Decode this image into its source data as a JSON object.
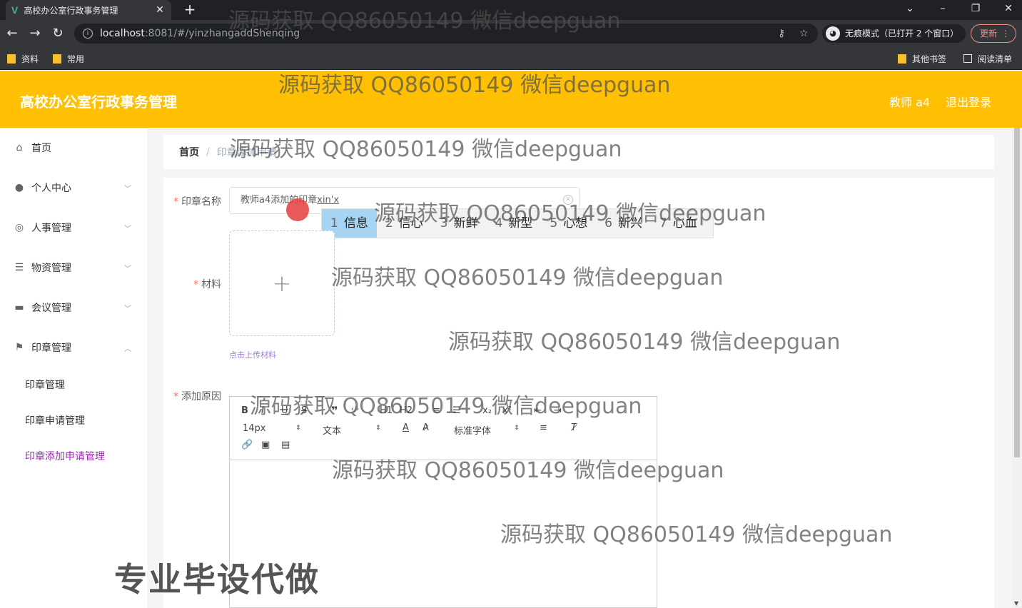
{
  "browser": {
    "tab_title": "高校办公室行政事务管理",
    "tab_logo": "V",
    "tab_close": "✕",
    "new_tab": "+",
    "url_host": "localhost",
    "url_rest": ":8081/#/yinzhangaddShenqing",
    "incognito": "无痕模式（已打开 2 个窗口）",
    "update_label": "更新",
    "bookmarks": [
      "资料",
      "常用"
    ],
    "other_bookmarks": "其他书签",
    "reading_list": "阅读清单",
    "icons": [
      "back-icon",
      "forward-icon",
      "reload-icon",
      "info-icon",
      "key-icon",
      "star-icon",
      "incognito-icon",
      "menu-dots-icon",
      "folder-icon",
      "minimize-icon",
      "restore-icon",
      "close-icon",
      "chevron-down-icon"
    ]
  },
  "header": {
    "title": "高校办公室行政事务管理",
    "user": "教师 a4",
    "logout": "退出登录",
    "bg_color": "#ffc003"
  },
  "sidebar": {
    "items": [
      {
        "label": "首页",
        "icon": "home-icon"
      },
      {
        "label": "个人中心",
        "icon": "user-icon"
      },
      {
        "label": "人事管理",
        "icon": "compass-icon"
      },
      {
        "label": "物资管理",
        "icon": "list-icon"
      },
      {
        "label": "会议管理",
        "icon": "monitor-icon"
      },
      {
        "label": "印章管理",
        "icon": "flag-icon"
      }
    ],
    "sub_items": [
      "印章管理",
      "印章申请管理",
      "印章添加申请管理"
    ],
    "active_color": "#9c27b0"
  },
  "breadcrumb": {
    "home": "首页",
    "sep": "/",
    "current": "印章添加申请"
  },
  "form": {
    "name_label": "印章名称",
    "name_value_prefix": "教师a4添加的印章",
    "name_value_typed": "xin'x",
    "material_label": "材料",
    "upload_plus": "+",
    "upload_tip": "点击上传材料",
    "reason_label": "添加原因",
    "required_mark": "*"
  },
  "ime": {
    "candidates": [
      {
        "num": "1",
        "text": "信息"
      },
      {
        "num": "2",
        "text": "信心"
      },
      {
        "num": "3",
        "text": "新鲜"
      },
      {
        "num": "4",
        "text": "新型"
      },
      {
        "num": "5",
        "text": "心想"
      },
      {
        "num": "6",
        "text": "新兴"
      },
      {
        "num": "7",
        "text": "心血"
      }
    ]
  },
  "editor": {
    "toolbar_row1": [
      "B",
      "I",
      "U",
      "S",
      "❞",
      "‹/›",
      "H1",
      "H2",
      "≡",
      "☰",
      "x₂",
      "x²",
      "⇤",
      "⇥"
    ],
    "font_size": "14px",
    "header_type": "文本",
    "font_family": "标准字体",
    "toolbar_row3": [
      "link-icon",
      "image-icon",
      "video-icon"
    ]
  },
  "watermark": {
    "text": "源码获取 QQ86050149 微信deepguan",
    "big_text": "专业毕设代做"
  }
}
